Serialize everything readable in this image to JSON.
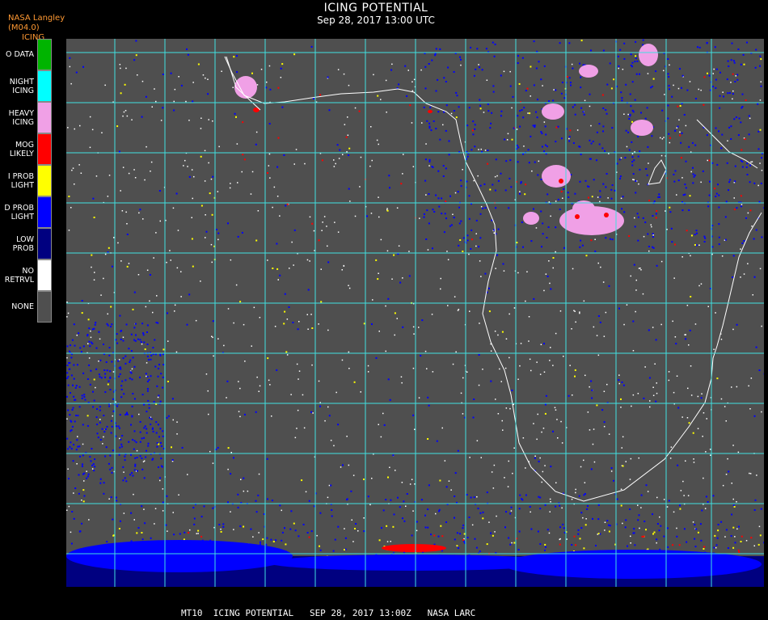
{
  "header": {
    "brand": "NASA Langley (M04.0)",
    "product": "ICING",
    "title": "ICING POTENTIAL",
    "datetime": "Sep 28, 2017 13:00 UTC"
  },
  "legend": [
    {
      "label": "O DATA",
      "color": "#00b400"
    },
    {
      "label": "NIGHT\nICING",
      "color": "#00ffff"
    },
    {
      "label": "HEAVY\nICING",
      "color": "#f0a0e6"
    },
    {
      "label": "MOG\nLIKELY",
      "color": "#ff0000"
    },
    {
      "label": "I PROB\nLIGHT",
      "color": "#ffff00"
    },
    {
      "label": "D PROB\nLIGHT",
      "color": "#0000ff"
    },
    {
      "label": "LOW\nPROB",
      "color": "#000080"
    },
    {
      "label": "NO\nRETRVL",
      "color": "#ffffff"
    },
    {
      "label": "NONE",
      "color": "#4f4f4f"
    }
  ],
  "map": {
    "background_color": "#4f4f4f",
    "grid_color": "#40e0e0",
    "coast_color": "#ffffff"
  },
  "footer": {
    "caption": "MT10  ICING POTENTIAL   SEP 28, 2017 13:00Z   NASA LARC"
  }
}
